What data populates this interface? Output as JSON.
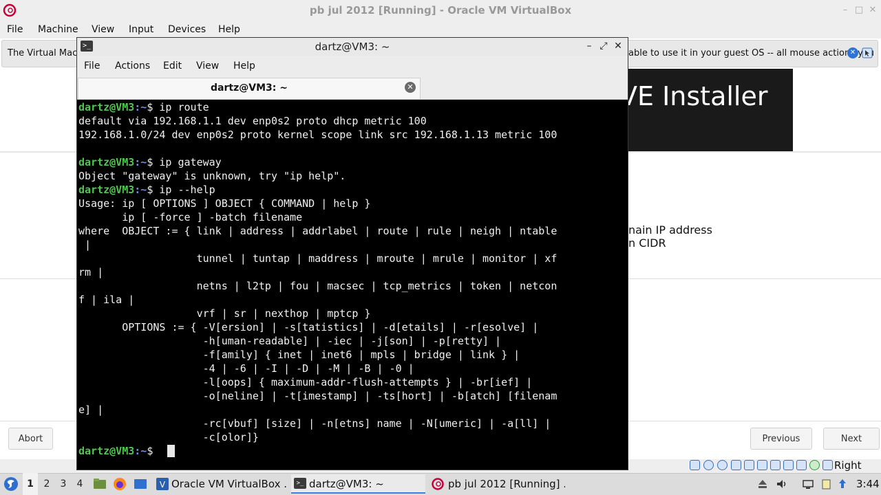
{
  "host_window": {
    "title": "pb jul 2012 [Running] - Oracle VM VirtualBox",
    "menu": [
      "File",
      "Machine",
      "View",
      "Input",
      "Devices",
      "Help"
    ],
    "notification": {
      "text_left": "The Virtual Mach",
      "text_right": "able to use it in your guest OS -- all mouse actions you"
    },
    "status_right": "Right Ctrl"
  },
  "guest": {
    "banner_text": "VE Installer",
    "line1": "nain IP address",
    "line2": "n CIDR",
    "abort_label": "Abort",
    "previous_label": "Previous",
    "next_label": "Next"
  },
  "terminal": {
    "title": "dartz@VM3: ~",
    "menu": [
      "File",
      "Actions",
      "Edit",
      "View",
      "Help"
    ],
    "tab_label": "dartz@VM3: ~",
    "prompt_user": "dartz@VM3",
    "prompt_path": ":~",
    "prompt_sigil": "$ ",
    "commands": [
      "ip route",
      "ip gateway",
      "ip --help"
    ],
    "output_route": [
      "default via 192.168.1.1 dev enp0s2 proto dhcp metric 100",
      "192.168.1.0/24 dev enp0s2 proto kernel scope link src 192.168.1.13 metric 100"
    ],
    "output_gateway": "Object \"gateway\" is unknown, try \"ip help\".",
    "output_help": [
      "Usage: ip [ OPTIONS ] OBJECT { COMMAND | help }",
      "       ip [ -force ] -batch filename",
      "where  OBJECT := { link | address | addrlabel | route | rule | neigh | ntable",
      " |",
      "                   tunnel | tuntap | maddress | mroute | mrule | monitor | xf",
      "rm |",
      "                   netns | l2tp | fou | macsec | tcp_metrics | token | netcon",
      "f | ila |",
      "                   vrf | sr | nexthop | mptcp }",
      "       OPTIONS := { -V[ersion] | -s[tatistics] | -d[etails] | -r[esolve] |",
      "                    -h[uman-readable] | -iec | -j[son] | -p[retty] |",
      "                    -f[amily] { inet | inet6 | mpls | bridge | link } |",
      "                    -4 | -6 | -I | -D | -M | -B | -0 |",
      "                    -l[oops] { maximum-addr-flush-attempts } | -br[ief] |",
      "                    -o[neline] | -t[imestamp] | -ts[hort] | -b[atch] [filenam",
      "e] |",
      "                    -rc[vbuf] [size] | -n[etns] name | -N[umeric] | -a[ll] |",
      "                    -c[olor]}"
    ]
  },
  "taskbar": {
    "workspaces": [
      "1",
      "2",
      "3",
      "4"
    ],
    "tasks": [
      "Oracle VM VirtualBox ...",
      "dartz@VM3: ~",
      "pb jul 2012 [Running] ..."
    ],
    "clock": "3:44"
  },
  "colors": {
    "terminal_bg": "#000000",
    "prompt_user": "#4ec94e",
    "prompt_path": "#6e8fe0",
    "accent": "#3d7fe0"
  }
}
